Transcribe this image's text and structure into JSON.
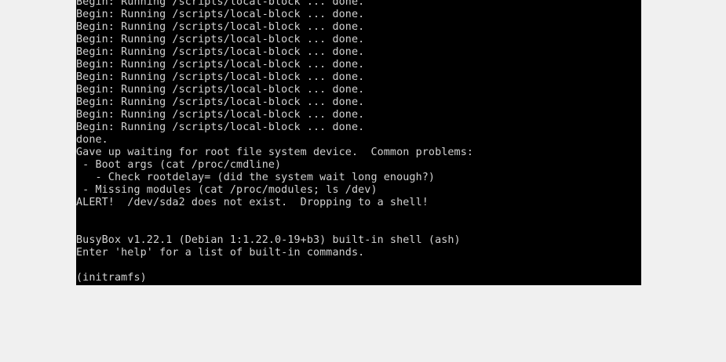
{
  "terminal": {
    "colors": {
      "background": "#000000",
      "text": "#d2d2d2",
      "page": "#f0f0f0"
    },
    "lines": [
      "Begin: Running /scripts/local-block ... done.",
      "Begin: Running /scripts/local-block ... done.",
      "Begin: Running /scripts/local-block ... done.",
      "Begin: Running /scripts/local-block ... done.",
      "Begin: Running /scripts/local-block ... done.",
      "Begin: Running /scripts/local-block ... done.",
      "Begin: Running /scripts/local-block ... done.",
      "Begin: Running /scripts/local-block ... done.",
      "Begin: Running /scripts/local-block ... done.",
      "Begin: Running /scripts/local-block ... done.",
      "Begin: Running /scripts/local-block ... done.",
      "done.",
      "Gave up waiting for root file system device.  Common problems:",
      " - Boot args (cat /proc/cmdline)",
      "   - Check rootdelay= (did the system wait long enough?)",
      " - Missing modules (cat /proc/modules; ls /dev)",
      "ALERT!  /dev/sda2 does not exist.  Dropping to a shell!",
      "",
      "",
      "BusyBox v1.22.1 (Debian 1:1.22.0-19+b3) built-in shell (ash)",
      "Enter 'help' for a list of built-in commands.",
      "",
      "(initramfs)"
    ]
  }
}
